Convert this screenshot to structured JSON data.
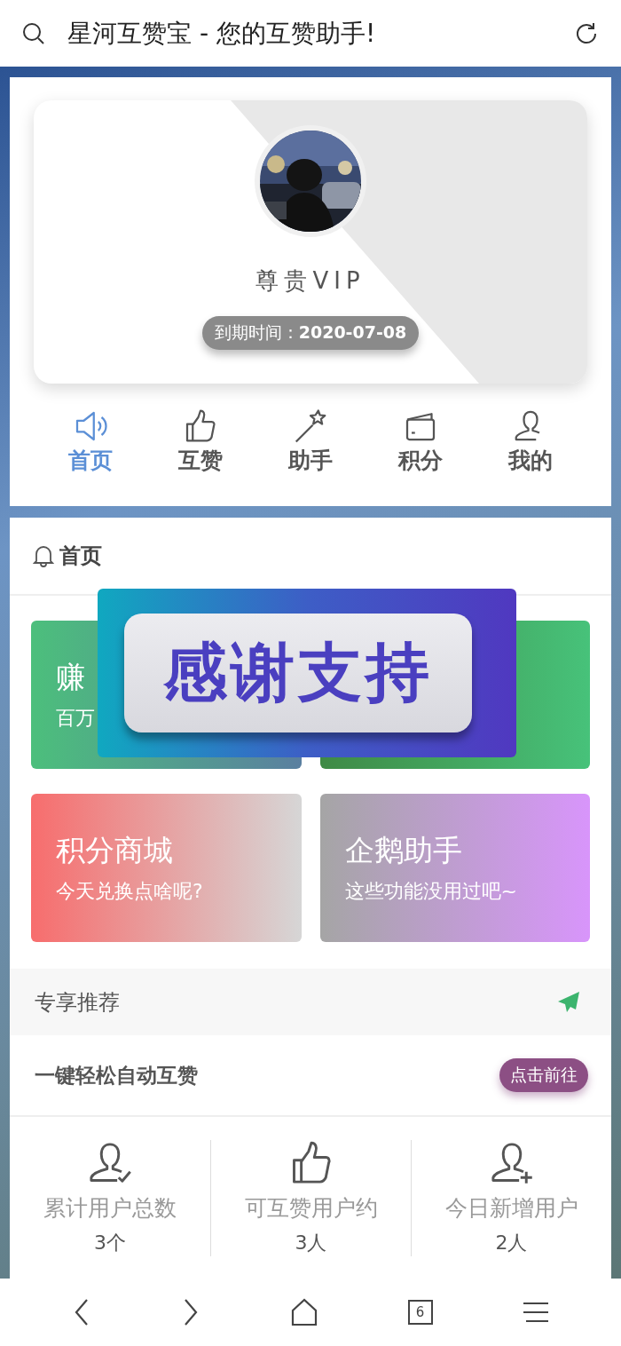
{
  "browser_bar": {
    "title": "星河互赞宝 - 您的互赞助手!"
  },
  "profile": {
    "level": "尊贵VIP",
    "expiry": "到期时间：**2020-07-08**"
  },
  "nav_tabs": [
    {
      "label": "首页",
      "kind": "speaker",
      "selected": true
    },
    {
      "label": "互赞",
      "kind": "thumb",
      "selected": false
    },
    {
      "label": "助手",
      "kind": "wand",
      "selected": false
    },
    {
      "label": "积分",
      "kind": "wallet",
      "selected": false
    },
    {
      "label": "我的",
      "kind": "person",
      "selected": false
    }
  ],
  "section": {
    "title": "首页"
  },
  "feature_cards": [
    {
      "kind": "teal",
      "title": "赚",
      "subtitle": "百万"
    },
    {
      "kind": "green"
    },
    {
      "kind": "coral",
      "title": "积分商城",
      "subtitle": "今天兑换点啥呢?"
    },
    {
      "kind": "violet",
      "title": "企鹅助手",
      "subtitle": "这些功能没用过吧~"
    }
  ],
  "overlay_banner": {
    "text": "感谢支持"
  },
  "recommend": {
    "title": "专享推荐"
  },
  "promo": {
    "text": "一键轻松自动互赞",
    "button": "点击前往"
  },
  "stats": [
    {
      "kind": "user-check",
      "label": "累计用户总数",
      "value": "3个"
    },
    {
      "kind": "thumb",
      "label": "可互赞用户约",
      "value": "3人"
    },
    {
      "kind": "user-plus",
      "label": "今日新增用户",
      "value": "2人"
    }
  ],
  "bottom_nav": {
    "tab_count": "6"
  }
}
